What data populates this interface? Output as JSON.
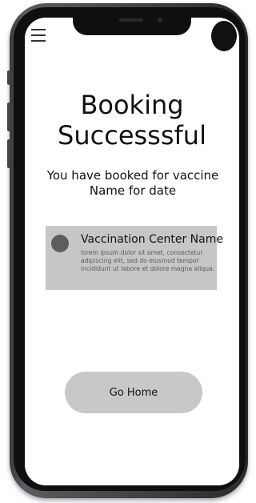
{
  "page": {
    "title_line1": "Booking",
    "title_line2": "Successsful",
    "subtitle": "You have booked for vaccine Name for date"
  },
  "header": {
    "menu_icon": "hamburger-icon",
    "avatar": "profile-avatar"
  },
  "center_card": {
    "name": "Vaccination Center Name",
    "description": "lorem ipsum dolor sit amet, consectetur adipiscing elit, sed do eiusmod tempor incididunt ut labore et dolore magna aliqua.",
    "icon": "circle-placeholder-icon"
  },
  "actions": {
    "go_home_label": "Go Home"
  },
  "colors": {
    "card_background": "#c6c6c6",
    "button_background": "#c8c8c8",
    "dot": "#5d5d5d"
  }
}
